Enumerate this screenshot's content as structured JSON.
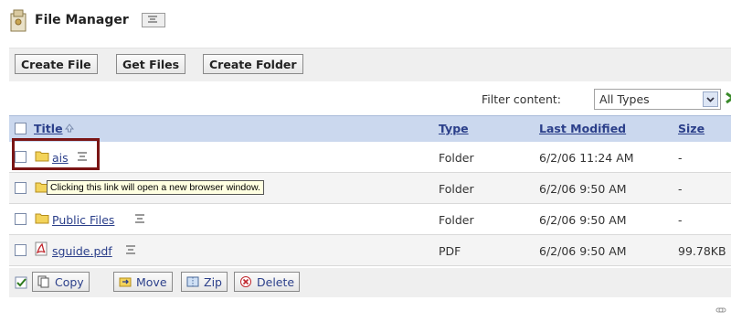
{
  "header": {
    "title": "File Manager",
    "menu_icon": "mini-menu-icon"
  },
  "toolbar": {
    "create_file": "Create File",
    "get_files": "Get Files",
    "create_folder": "Create Folder"
  },
  "filter": {
    "label": "Filter content:",
    "selected": "All Types"
  },
  "table": {
    "columns": {
      "title": "Title",
      "type": "Type",
      "modified": "Last Modified",
      "size": "Size"
    },
    "rows": [
      {
        "name": "ais",
        "type": "Folder",
        "modified": "6/2/06 11:24 AM",
        "size": "-"
      },
      {
        "name": "",
        "type": "Folder",
        "modified": "6/2/06 9:50 AM",
        "size": "-"
      },
      {
        "name": "Public Files",
        "type": "Folder",
        "modified": "6/2/06 9:50 AM",
        "size": "-"
      },
      {
        "name": "sguide.pdf",
        "type": "PDF",
        "modified": "6/2/06 9:50 AM",
        "size": "99.78KB"
      }
    ]
  },
  "tooltip": "Clicking this link will open a new browser window.",
  "actions": {
    "copy": "Copy",
    "move": "Move",
    "zip": "Zip",
    "delete": "Delete"
  },
  "colors": {
    "accent": "#2b3f8a",
    "header_bg": "#cbd8ee",
    "highlight": "#7a1515",
    "tooltip_bg": "#ffffe1"
  }
}
